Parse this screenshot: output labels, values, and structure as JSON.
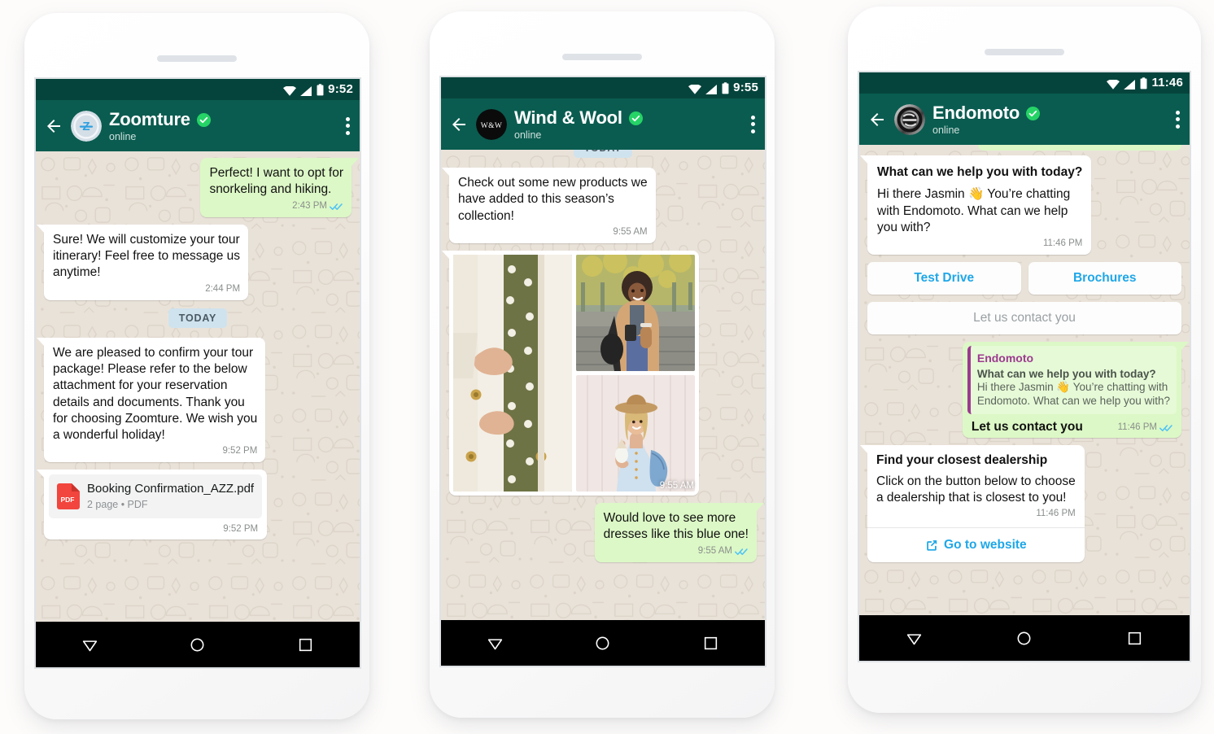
{
  "phones": [
    {
      "id": "zoomture",
      "status": {
        "time": "9:52",
        "wifi": "wifi-icon",
        "signal": "signal-icon",
        "battery": "battery-icon"
      },
      "header": {
        "back": "back-arrow-icon",
        "avatar": "zoomture-avatar",
        "name": "Zoomture",
        "verified": "verified-badge-icon",
        "presence": "online",
        "menu": "overflow-menu-icon"
      },
      "messages": [
        {
          "kind": "out",
          "text": "Perfect! I want to opt for\nsnorkeling and hiking.",
          "time": "2:43 PM",
          "ticks": "read-ticks-icon"
        },
        {
          "kind": "in",
          "text": "Sure! We will customize your tour\nitinerary! Feel free to message us\nanytime!",
          "time": "2:44 PM"
        },
        {
          "kind": "day",
          "label": "TODAY"
        },
        {
          "kind": "in",
          "text": "We are pleased to confirm your tour\npackage! Please refer to the below\nattachment for your reservation\ndetails and documents. Thank you\nfor choosing Zoomture. We wish you\na wonderful holiday!",
          "time": "9:52 PM"
        },
        {
          "kind": "doc",
          "filename": "Booking Confirmation_AZZ.pdf",
          "subtitle": "2 page • PDF",
          "badge": "PDF",
          "time": "9:52 PM"
        }
      ],
      "composer": {
        "placeholder": "",
        "value": "",
        "send": "send-icon"
      },
      "nav": {
        "back": "nav-back-icon",
        "home": "nav-home-icon",
        "recents": "nav-recents-icon"
      }
    },
    {
      "id": "wind-and-wool",
      "status": {
        "time": "9:55",
        "wifi": "wifi-icon",
        "signal": "signal-icon",
        "battery": "battery-icon"
      },
      "header": {
        "back": "back-arrow-icon",
        "avatar": "wind-and-wool-avatar",
        "avatar_text": "W&W",
        "name": "Wind & Wool",
        "verified": "verified-badge-icon",
        "presence": "online",
        "menu": "overflow-menu-icon"
      },
      "messages": [
        {
          "kind": "day",
          "label": "TODAY"
        },
        {
          "kind": "in",
          "text": "Check out some new products we\nhave added to this season’s\ncollection!",
          "time": "9:55 AM"
        },
        {
          "kind": "album",
          "time": "9:55 AM",
          "photos": [
            {
              "name": "photo-polka-dot-dress-and-cardigan"
            },
            {
              "name": "photo-woman-in-camel-coat-autumn-street"
            },
            {
              "name": "photo-woman-in-light-blue-dress-with-hat"
            }
          ]
        },
        {
          "kind": "out",
          "text": "Would love to see more\ndresses like this blue one!",
          "time": "9:55 AM",
          "ticks": "read-ticks-icon"
        }
      ],
      "composer": {
        "placeholder": "",
        "value": "",
        "send": "send-icon"
      },
      "nav": {
        "back": "nav-back-icon",
        "home": "nav-home-icon",
        "recents": "nav-recents-icon"
      }
    },
    {
      "id": "endomoto",
      "status": {
        "time": "11:46",
        "wifi": "wifi-icon",
        "signal": "signal-icon",
        "battery": "battery-icon"
      },
      "header": {
        "back": "back-arrow-icon",
        "avatar": "endomoto-avatar",
        "name": "Endomoto",
        "verified": "verified-badge-icon",
        "presence": "online",
        "menu": "overflow-menu-icon"
      },
      "messages": [
        {
          "kind": "in-rich",
          "title": "What can we help you with today?",
          "body": "Hi there Jasmin 👋 You’re chatting\nwith Endomoto. What can we help\nyou with?",
          "time": "11:46 PM"
        },
        {
          "kind": "options-row",
          "options": [
            "Test Drive",
            "Brochures"
          ]
        },
        {
          "kind": "option-disabled",
          "label": "Let us contact you"
        },
        {
          "kind": "out-quoted",
          "quote_name": "Endomoto",
          "quote_line1": "What can we help you with today?",
          "quote_line2": "Hi there Jasmin 👋 You’re chatting with\nEndomoto. What can we help you with?",
          "text": "Let us contact you",
          "time": "11:46 PM",
          "ticks": "read-ticks-icon"
        },
        {
          "kind": "cta",
          "title": "Find your closest dealership",
          "body": "Click on the button below to choose\na dealership that is closest to you!",
          "time": "11:46 PM",
          "link_label": "Go to website",
          "link_icon": "external-link-icon"
        }
      ],
      "nav": {
        "back": "nav-back-icon",
        "home": "nav-home-icon",
        "recents": "nav-recents-icon"
      }
    }
  ],
  "colors": {
    "statusbar": "#05443c",
    "appbar": "#0a5c50",
    "chat_bg": "#e9e2d9",
    "outgoing_bubble": "#dcf8c6",
    "incoming_bubble": "#ffffff",
    "send_button": "#0c8074",
    "link_blue": "#1fa7e8",
    "quote_accent": "#9c3a8f",
    "verified_green": "#25d366",
    "day_chip": "#cfe3ee"
  }
}
